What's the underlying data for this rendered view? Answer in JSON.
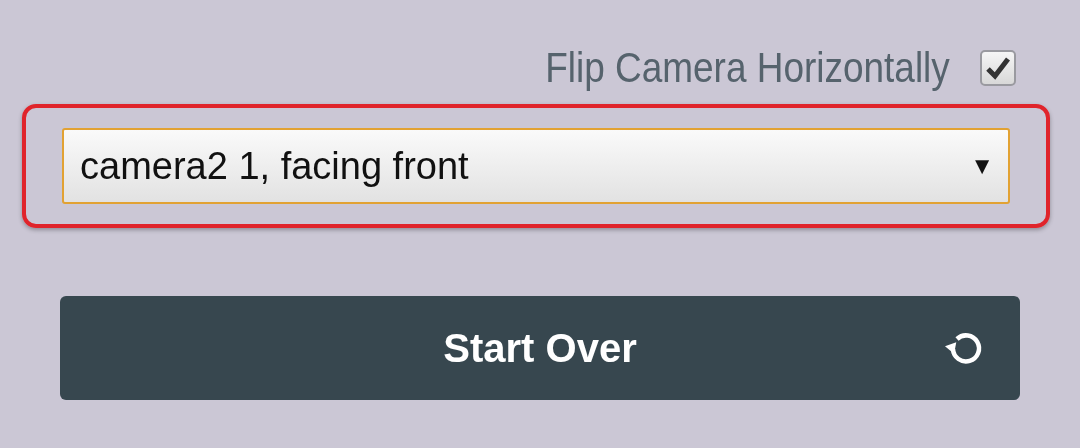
{
  "flip_camera": {
    "label": "Flip Camera Horizontally",
    "checked": true
  },
  "camera_select": {
    "value": "camera2 1, facing front",
    "arrow": "▼",
    "highlighted": true
  },
  "start_over_button": {
    "label": "Start Over"
  }
}
